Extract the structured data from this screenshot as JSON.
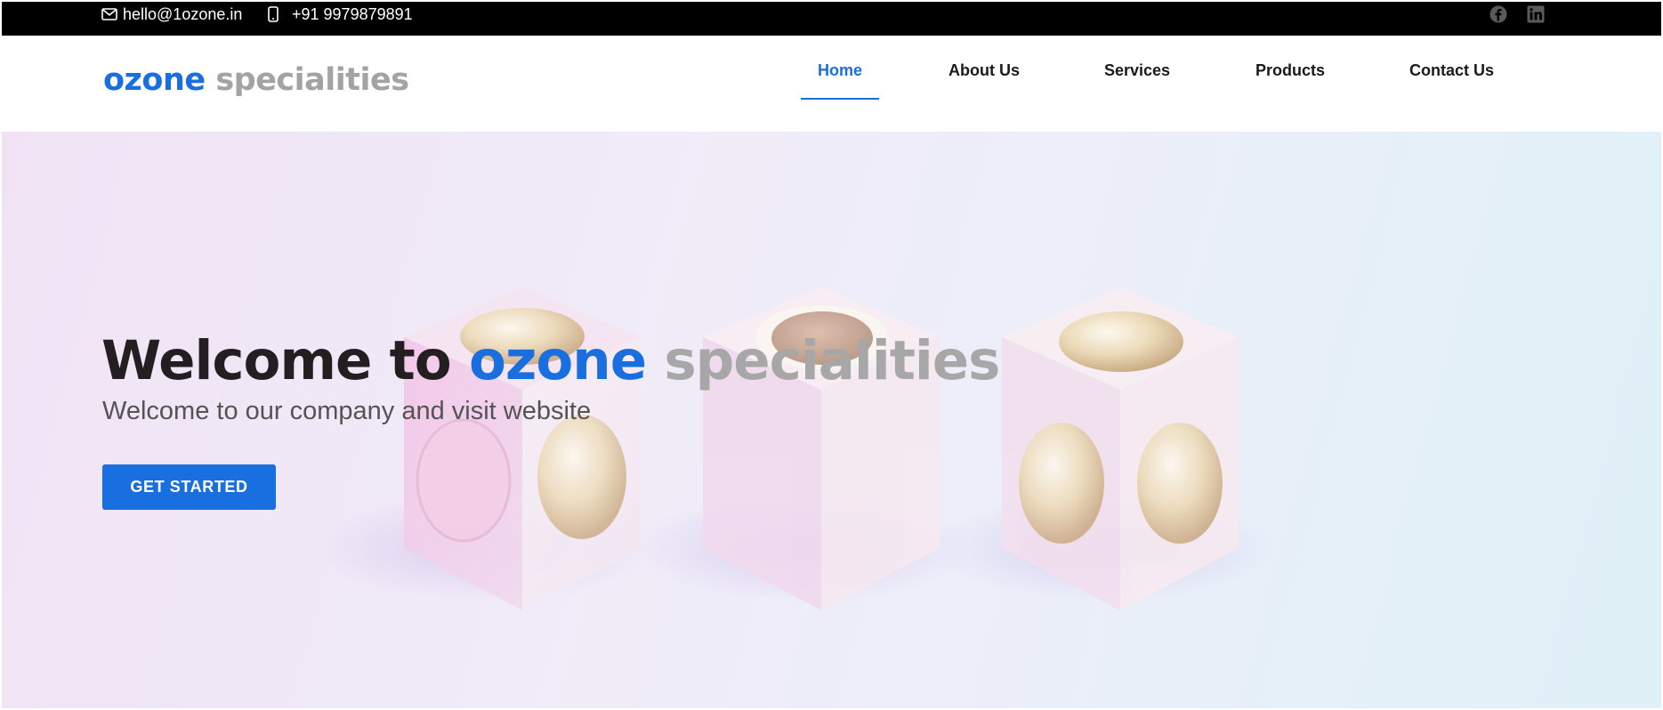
{
  "topbar": {
    "email": "hello@1ozone.in",
    "phone": "+91 9979879891",
    "icons": {
      "email": "envelope-icon",
      "phone": "mobile-phone-icon",
      "social": [
        "facebook-icon",
        "linkedin-icon"
      ]
    }
  },
  "header": {
    "logo": {
      "primary": "ozone",
      "secondary": "specialities"
    },
    "nav": [
      {
        "label": "Home",
        "active": true
      },
      {
        "label": "About Us",
        "active": false
      },
      {
        "label": "Services",
        "active": false
      },
      {
        "label": "Products",
        "active": false
      },
      {
        "label": "Contact Us",
        "active": false
      }
    ]
  },
  "hero": {
    "title_prefix": "Welcome to",
    "title_brand_primary": "ozone",
    "title_brand_secondary": "specialities",
    "subtitle": "Welcome to our company and visit website",
    "cta_label": "GET STARTED"
  },
  "colors": {
    "brand_blue": "#1a6fe0",
    "brand_gray": "#a3a3a3",
    "topbar_bg": "#000000",
    "heading_dark": "#231f20"
  }
}
